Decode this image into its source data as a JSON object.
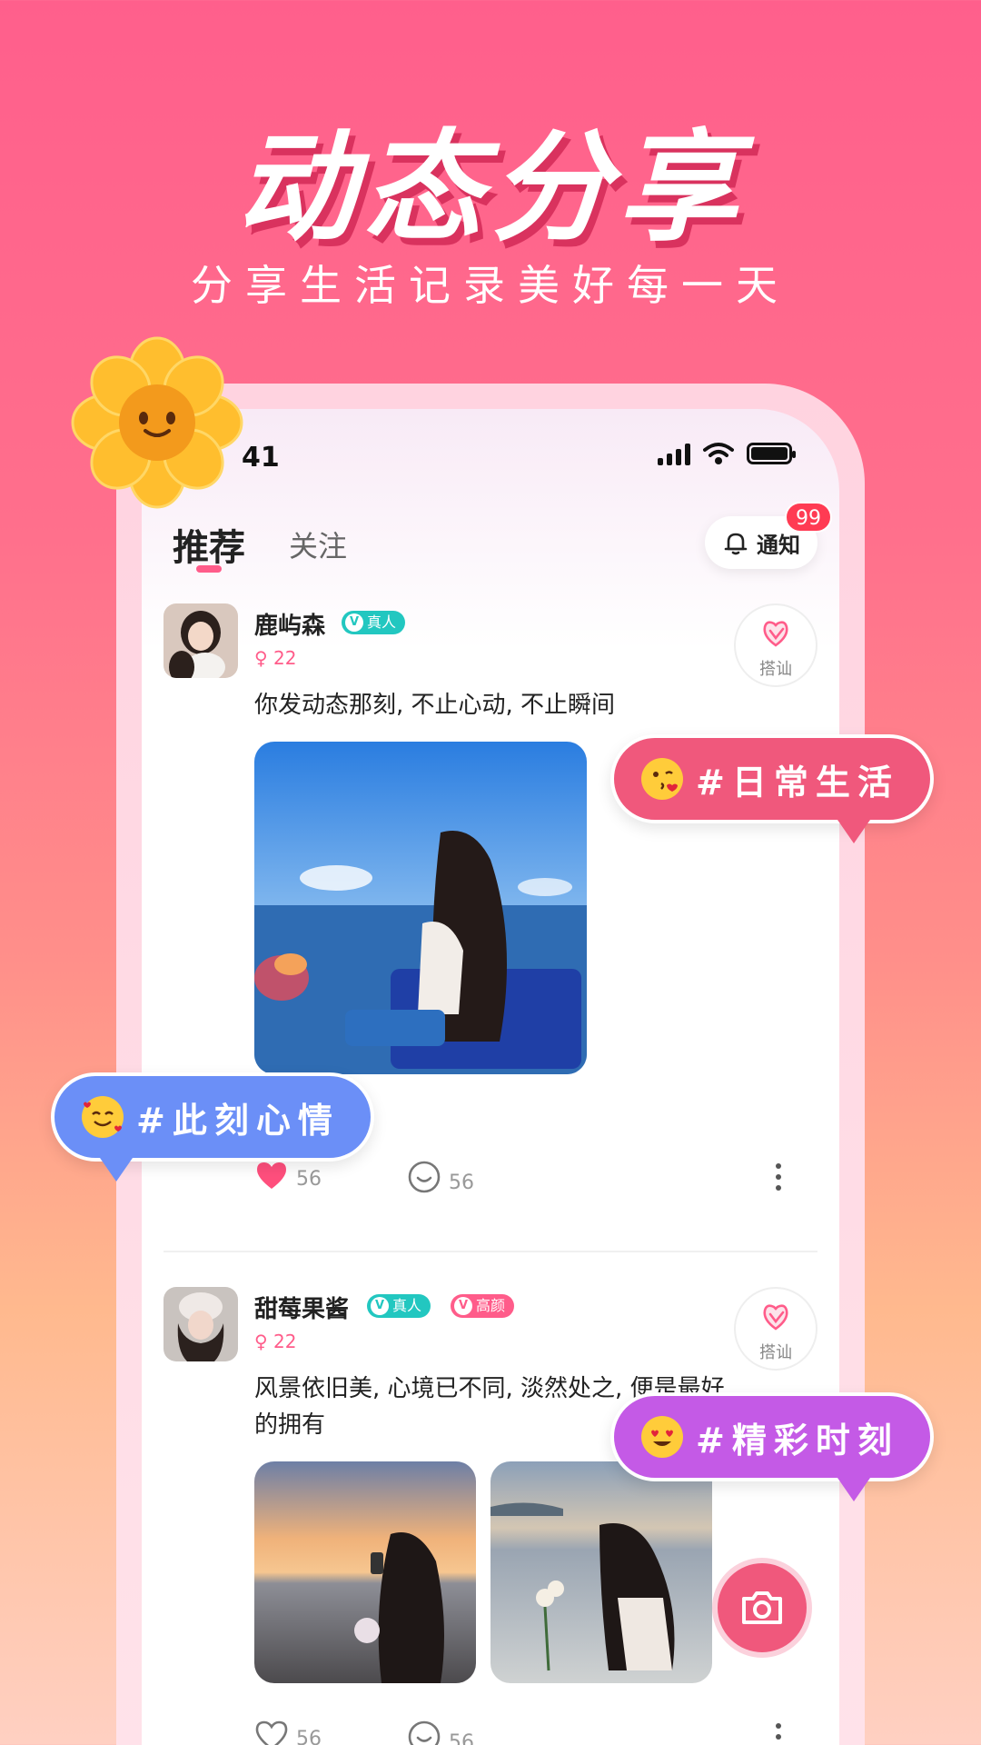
{
  "hero": {
    "title": "动态分享",
    "subtitle": "分享生活记录美好每一天"
  },
  "status_bar": {
    "time": "41"
  },
  "tabs": [
    {
      "label": "推荐"
    },
    {
      "label": "关注"
    }
  ],
  "notify": {
    "label": "通知",
    "badge": "99"
  },
  "posts": [
    {
      "username": "鹿屿森",
      "badges": [
        "真人"
      ],
      "age": "22",
      "caption": "你发动态那刻, 不止心动, 不止瞬间",
      "greet_label": "搭讪",
      "likes": "56",
      "comments": "56",
      "liked": true
    },
    {
      "username": "甜莓果酱",
      "badges": [
        "真人",
        "高颜"
      ],
      "age": "22",
      "caption": "风景依旧美, 心境已不同, 淡然处之, 便是最好的拥有",
      "greet_label": "搭讪",
      "likes": "56",
      "comments": "56",
      "liked": false
    }
  ],
  "bubbles": {
    "daily": "#日常生活",
    "mood": "#此刻心情",
    "moment": "#精彩时刻"
  },
  "colors": {
    "accent": "#f0587c",
    "real_badge": "#22c7c0",
    "mood_bubble": "#6b8ff7",
    "moment_bubble": "#c45ae6"
  }
}
